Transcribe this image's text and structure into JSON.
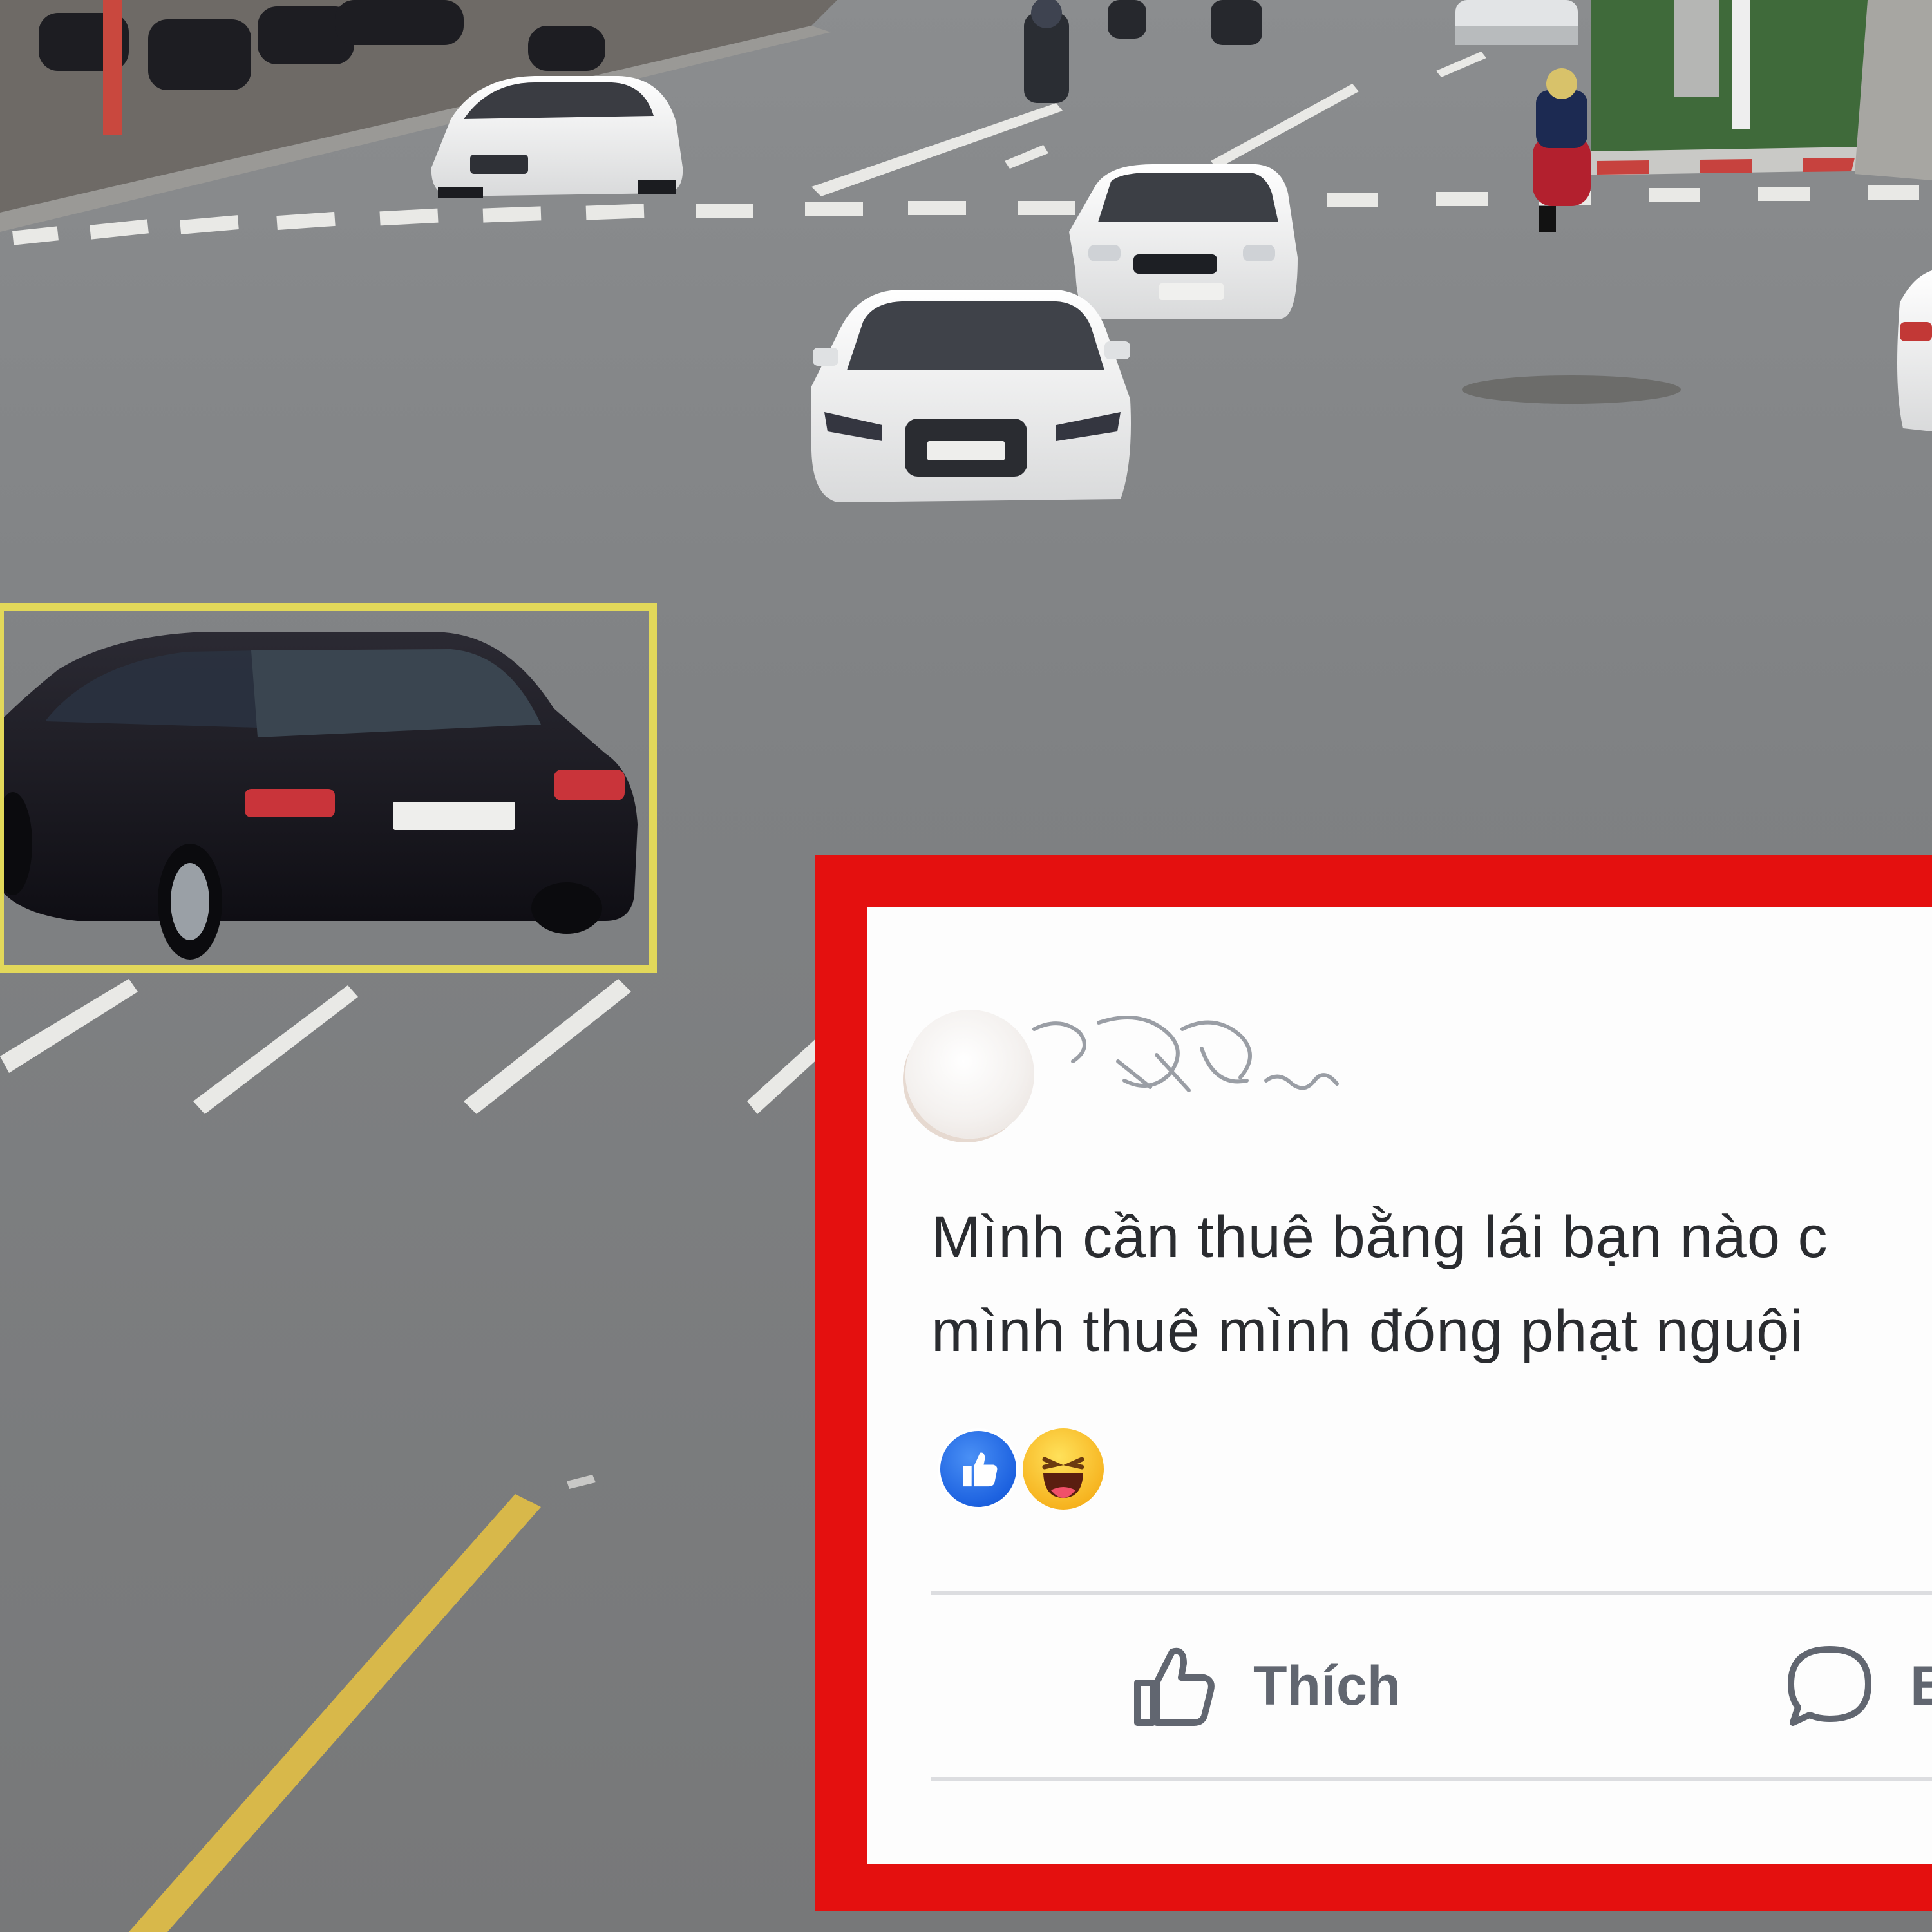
{
  "scene": {
    "description_colors": {
      "road": "#7d7f80",
      "lane_marking": "#e9e9e6",
      "yellow_line": "#d8b84a",
      "highlight_box": "#e2d85a",
      "median_grass": "#3f6a3a"
    },
    "vehicles": {
      "highlighted_car_plate": "",
      "highlight_color": "#e2d85a"
    }
  },
  "post": {
    "frame_color": "#e4100f",
    "text_line_1": "Mình cần thuê bằng lái bạn nào c",
    "text_line_2": "mình thuê mình đóng phạt nguội",
    "reactions": [
      "like-reaction-icon",
      "haha-reaction-icon"
    ],
    "actions": {
      "like_label": "Thích",
      "comment_label": "B"
    }
  }
}
